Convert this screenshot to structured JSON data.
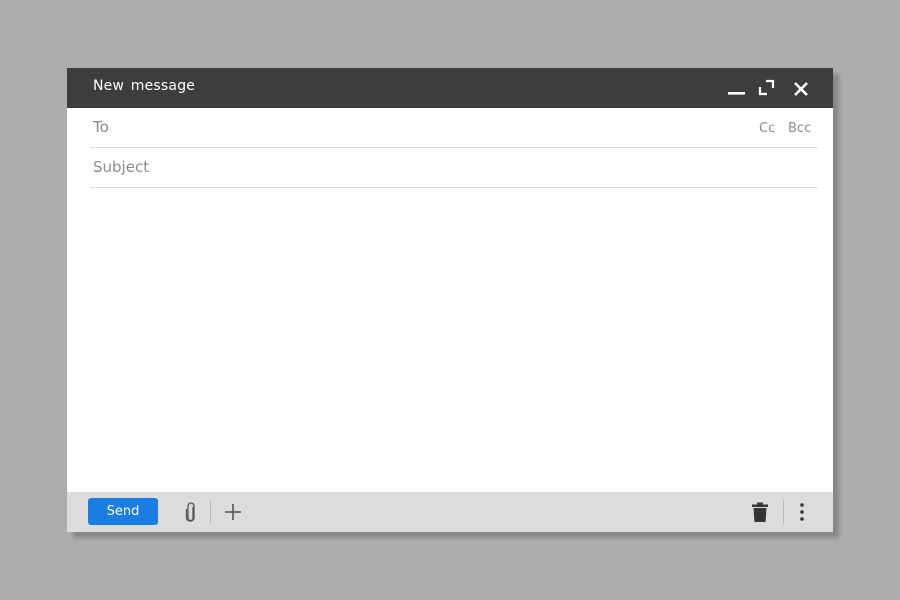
{
  "window": {
    "title": "New message",
    "controls": [
      {
        "name": "minimize",
        "icon": "minimize-icon"
      },
      {
        "name": "expand",
        "icon": "expand-icon"
      },
      {
        "name": "close",
        "icon": "close-icon"
      }
    ]
  },
  "fields": {
    "to": {
      "label": "To",
      "value": ""
    },
    "subject": {
      "label": "Subject",
      "value": ""
    },
    "cc_label": "Cc",
    "bcc_label": "Bcc",
    "body": ""
  },
  "footer": {
    "send_label": "Send",
    "icons": [
      "paperclip-icon",
      "plus-icon",
      "trash-icon",
      "more-vertical-icon"
    ]
  },
  "colors": {
    "titlebar": "#3d3d3d",
    "send_button": "#1a7de3",
    "footer": "#dcdcdc",
    "background": "#adadad"
  }
}
